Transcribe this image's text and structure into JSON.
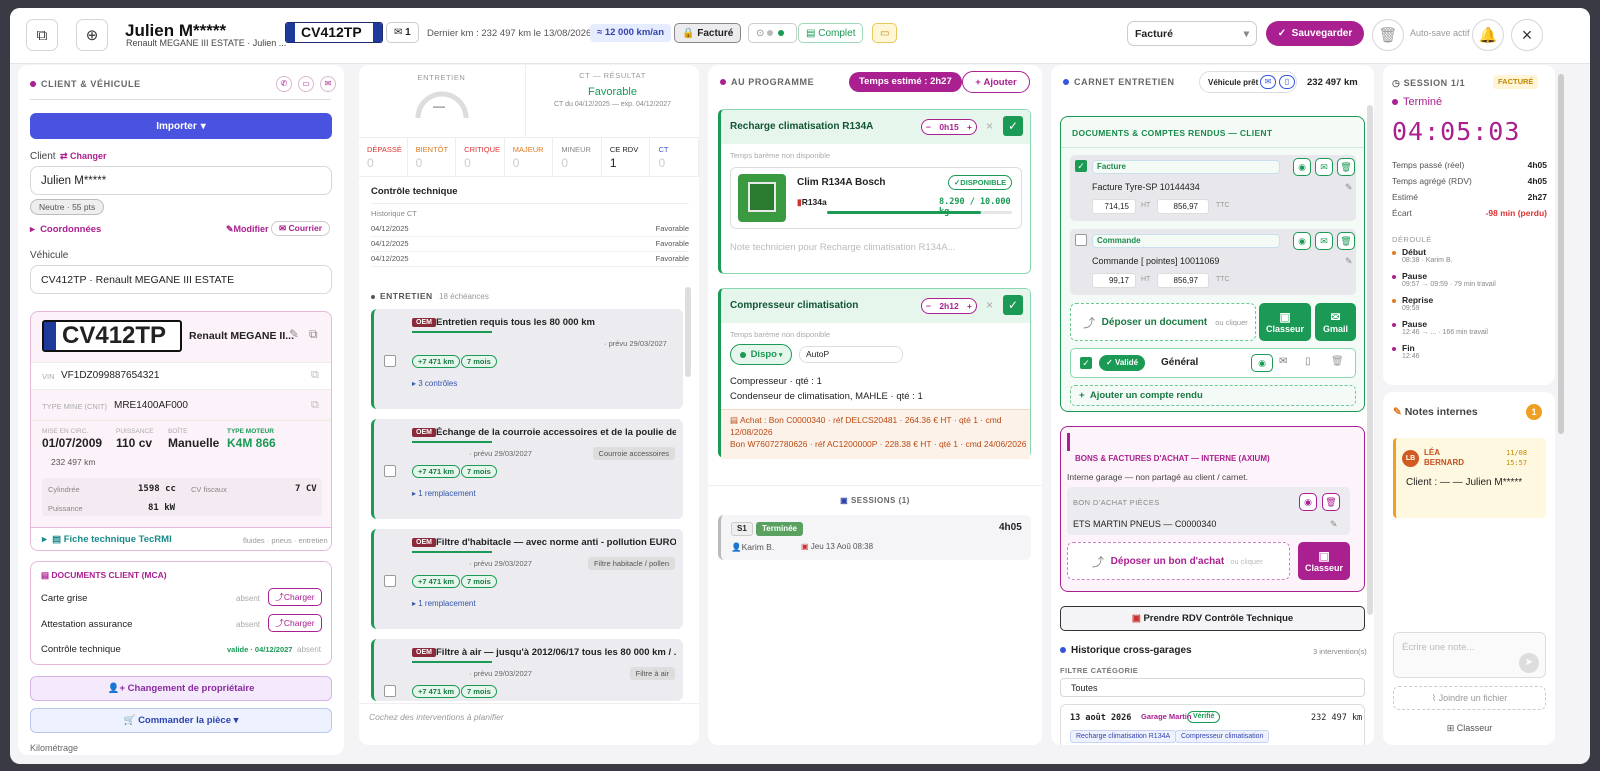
{
  "header": {
    "client_name": "Julien M*****",
    "vehicle_sub": "Renault MEGANE III ESTATE · Julien ...",
    "plate": "CV412TP",
    "mail_count": "1",
    "last_km": "Dernier km : 232 497 km le 13/08/2026",
    "km_year": "≈ 12 000 km/an",
    "status_badge": "Facturé",
    "complete_badge": "Complet",
    "status_select": "Facturé",
    "save_label": "Sauvegarder",
    "autosave": "Auto-save actif"
  },
  "client": {
    "section_title": "CLIENT & VÉHICULE",
    "import_label": "Importer",
    "client_label": "Client",
    "change_label": "Changer",
    "client_value": "Julien M*****",
    "score_badge": "Neutre · 55 pts",
    "coords_label": "Coordonnées",
    "modify_label": "Modifier",
    "mail_label": "Courrier",
    "vehicle_label": "Véhicule",
    "vehicle_value": "CV412TP · Renault MEGANE III ESTATE",
    "plate": "CV412TP",
    "model": "Renault MEGANE II...",
    "vin_label": "VIN",
    "vin": "VF1DZ099887654321",
    "mine_label": "TYPE MINE (CNIT)",
    "mine": "MRE1400AF000",
    "spec_labels": [
      "MISE EN CIRC.",
      "PUISSANCE",
      "BOÎTE",
      "TYPE MOTEUR"
    ],
    "spec_values": [
      "01/07/2009",
      "110 cv",
      "Manuelle",
      "K4M 866"
    ],
    "km": "232 497 km",
    "cyl_label": "Cylindrée",
    "cyl": "1598 cc",
    "cvf_label": "CV fiscaux",
    "cvf": "7 CV",
    "pw_label": "Puissance",
    "pw": "81 kW",
    "tecrmi": "Fiche technique TecRMI",
    "tecrmi_sub": "fluides · pneus · entretien",
    "docs_title": "DOCUMENTS CLIENT (MCA)",
    "docs": [
      {
        "name": "Carte grise",
        "state": "absent",
        "action": "Charger"
      },
      {
        "name": "Attestation assurance",
        "state": "absent",
        "action": "Charger"
      },
      {
        "name": "Contrôle technique",
        "valid": "valide · 04/12/2027",
        "state": "absent"
      }
    ],
    "owner_change": "Changement de propriétaire",
    "order_part": "Commander la pièce",
    "cut_label": "Kilométrage"
  },
  "maint": {
    "entretien_label": "ENTRETIEN",
    "gauge_value": "—",
    "ct_title": "CT — RÉSULTAT",
    "ct_result": "Favorable",
    "ct_sub": "CT du 04/12/2025 — exp. 04/12/2027",
    "stats": [
      {
        "k": "DÉPASSÉ",
        "v": "0"
      },
      {
        "k": "BIENTÔT",
        "v": "0"
      },
      {
        "k": "CRITIQUE",
        "v": "0"
      },
      {
        "k": "MAJEUR",
        "v": "0"
      },
      {
        "k": "MINEUR",
        "v": "0"
      },
      {
        "k": "CE RDV",
        "v": "1"
      },
      {
        "k": "CT",
        "v": "0"
      }
    ],
    "ct_section": "Contrôle technique",
    "ct_hist": "Historique CT",
    "ct_rows": [
      {
        "d": "04/12/2025",
        "r": "Favorable"
      },
      {
        "d": "04/12/2025",
        "r": "Favorable"
      },
      {
        "d": "04/12/2025",
        "r": "Favorable"
      }
    ],
    "ent_title": "ENTRETIEN",
    "ent_count": "18 échéances",
    "items": [
      {
        "title": "Entretien requis tous les 80 000 km",
        "due": "· prévu 29/03/2027",
        "cat": "",
        "km": "+7 471 km",
        "mo": "7 mois",
        "sub": "3 contrôles"
      },
      {
        "title": "Échange de la courroie accessoires et de la poulie de t...",
        "due": "· prévu 29/03/2027",
        "cat": "Courroie accessoires",
        "km": "+7 471 km",
        "mo": "7 mois",
        "sub": "1 remplacement"
      },
      {
        "title": "Filtre d'habitacle — avec norme anti - pollution EURO ...",
        "due": "· prévu 29/03/2027",
        "cat": "Filtre habitacle / pollen",
        "km": "+7 471 km",
        "mo": "7 mois",
        "sub": "1 remplacement"
      },
      {
        "title": "Filtre à air — jusqu'à 2012/06/17 tous les 80 000 km / ...",
        "due": "· prévu 29/03/2027",
        "cat": "Filtre à air",
        "km": "+7 471 km",
        "mo": "7 mois",
        "sub": ""
      }
    ],
    "oem": "OEM",
    "footer": "Cochez des interventions à planifier"
  },
  "prog": {
    "title": "AU PROGRAMME",
    "time_badge": "Temps estimé : 2h27",
    "add_label": "Ajouter",
    "job1": {
      "title": "Recharge climatisation R134A",
      "time": "0h15",
      "bareme": "Temps barème non disponible",
      "product": "Clim R134A Bosch",
      "avail": "DISPONIBLE",
      "ref": "R134a",
      "qty": "8.290 / 10.000 kg",
      "qty_frac": 0.83,
      "note": "Note technicien pour Recharge climatisation R134A..."
    },
    "job2": {
      "title": "Compresseur climatisation",
      "time": "2h12",
      "bareme": "Temps barème non disponible",
      "dispo": "Dispo",
      "autop": "AutoP",
      "line1": "Compresseur · qté : 1",
      "line2": "Condenseur de climatisation, MAHLE · qté : 1",
      "achat1": "Achat : Bon C0000340 · réf DELCS20481 · 264.36 € HT · qté 1 · cmd 12/08/2026",
      "achat2": "Bon W76072780626 · réf AC1200000P · 228.38 € HT · qté 1 · cmd 24/06/2026"
    },
    "sessions_title": "SESSIONS (1)",
    "session": {
      "id": "S1",
      "state": "Terminée",
      "dur": "4h05",
      "tech": "Karim B.",
      "date": "Jeu 13 Aoû 08:38"
    }
  },
  "carnet": {
    "title": "CARNET ENTRETIEN",
    "loan": "Véhicule prêt",
    "km": "232 497 km",
    "docs_title": "DOCUMENTS & COMPTES RENDUS — CLIENT",
    "doc1": {
      "type": "Facture",
      "name": "Facture Tyre-SP 10144434",
      "ht": "714,15",
      "ttc": "856,97"
    },
    "doc2": {
      "type": "Commande",
      "name": "Commande [ pointes] 10011069",
      "ht": "99,17",
      "ttc": "856,97"
    },
    "ht": "HT",
    "ttc": "TTC",
    "drop": "Déposer un document",
    "or_click": "ou cliquer",
    "classeur": "Classeur",
    "gmail": "Gmail",
    "validated": "Validé",
    "general": "Général",
    "add_report": "Ajouter un compte rendu",
    "purchase_title": "BONS & FACTURES D'ACHAT — INTERNE (AXIUM)",
    "purchase_sub": "Interne garage — non partagé au client / carnet.",
    "bon_label": "BON D'ACHAT PIÈCES",
    "bon_value": "ETS MARTIN PNEUS — C0000340",
    "drop_bon": "Déposer un bon d'achat",
    "rdv_ct": "Prendre RDV Contrôle Technique",
    "hist_title": "Historique cross-garages",
    "hist_count": "3 intervention(s)",
    "filter_label": "FILTRE CATÉGORIE",
    "filter_value": "Toutes",
    "hist_date": "13 août 2026",
    "hist_garage": "Garage Martin",
    "hist_verified": "Vérifié",
    "hist_km": "232 497 km",
    "hist_tags": [
      "Recharge climatisation R134A",
      "Compresseur climatisation"
    ]
  },
  "session": {
    "title": "SESSION 1/1",
    "badge": "FACTURÉ",
    "state": "Terminé",
    "clock": "04:05:03",
    "rows": [
      {
        "k": "Temps passé (réel)",
        "v": "4h05"
      },
      {
        "k": "Temps agrégé (RDV)",
        "v": "4h05"
      },
      {
        "k": "Estimé",
        "v": "2h27"
      },
      {
        "k": "Écart",
        "v": "-98 min (perdu)"
      }
    ],
    "timeline_title": "DÉROULÉ",
    "timeline": [
      {
        "t": "Début",
        "s": "08:38 · Karim B."
      },
      {
        "t": "Pause",
        "s": "09:57 → 09:59 · 79 min travail"
      },
      {
        "t": "Reprise",
        "s": "09:59"
      },
      {
        "t": "Pause",
        "s": "12:46 → ... · 166 min travail"
      },
      {
        "t": "Fin",
        "s": "12:46"
      }
    ],
    "notes_title": "Notes internes",
    "notes_count": "1",
    "note_initials": "LB",
    "note_author": "LÉA BERNARD",
    "note_date": "11/08 15:57",
    "note_text": "Client : — — Julien M*****",
    "note_placeholder": "Écrire une note...",
    "attach": "Joindre un fichier",
    "classeur": "Classeur"
  },
  "colors": {
    "accent": "#aa2090",
    "green": "#1a9a55",
    "orange": "#e07b20",
    "red": "#d33"
  }
}
